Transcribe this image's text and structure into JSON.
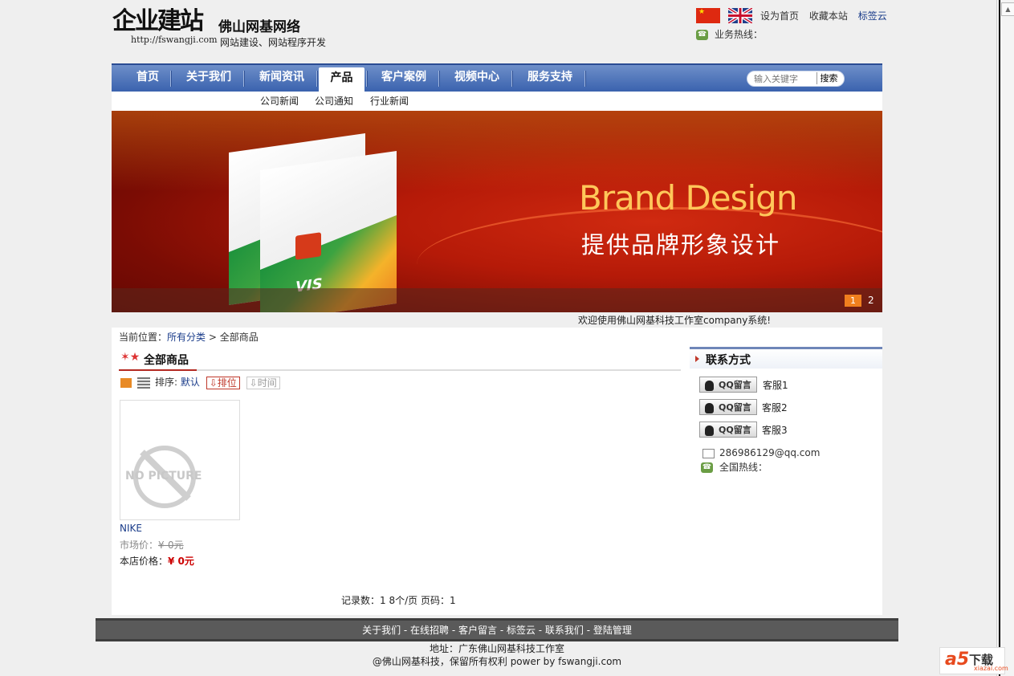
{
  "header": {
    "logo_title": "企业建站",
    "logo_url": "http://fswangji.com",
    "company_name": "佛山网基网络",
    "slogan": "网站建设、网站程序开发",
    "top_links": [
      "设为首页",
      "收藏本站",
      "标签云"
    ],
    "hotline_label": "业务热线："
  },
  "nav": {
    "items": [
      "首页",
      "关于我们",
      "新闻资讯",
      "产品",
      "客户案例",
      "视频中心",
      "服务支持"
    ],
    "active": "产品",
    "search_placeholder": "输入关键字",
    "search_button": "搜索",
    "subnav": [
      "公司新闻",
      "公司通知",
      "行业新闻"
    ]
  },
  "banner": {
    "title_en": "Brand Design",
    "title_cn": "提供品牌形象设计",
    "box_text": "VIS",
    "pager": [
      "1",
      "2"
    ]
  },
  "welcome": "欢迎使用佛山网基科技工作室company系统!",
  "breadcrumb": {
    "label": "当前位置：",
    "link": "所有分类",
    "separator": ">",
    "current": "全部商品"
  },
  "section": {
    "title": "全部商品",
    "sort_label": "排序:",
    "sort_default": "默认",
    "sort_rank": "排位",
    "sort_time": "时间"
  },
  "product": {
    "placeholder_text": "NO PICTURE",
    "name": "NIKE",
    "market_price_label": "市场价：",
    "market_price": "¥-0元",
    "shop_price_label": "本店价格：",
    "shop_price": "¥ 0元"
  },
  "pagination": {
    "records": "记录数：1",
    "per_page": "8个/页",
    "page": "页码：1"
  },
  "sidebar": {
    "title": "联系方式",
    "qq_button": "QQ留言",
    "services": [
      "客服1",
      "客服2",
      "客服3"
    ],
    "email": "286986129@qq.com",
    "hotline_label": "全国热线："
  },
  "footer": {
    "links": "关于我们 - 在线招聘 - 客户留言 - 标签云 - 联系我们 - 登陆管理",
    "address": "地址：广东佛山网基科技工作室",
    "copyright": "@佛山网基科技，保留所有权利  power by fswangji.com"
  },
  "watermark": {
    "logo": "a5",
    "text": "下载",
    "site": "xiazai.com"
  },
  "colors": {
    "nav_blue": "#3a62ae",
    "accent_orange": "#f07f1e",
    "price_red": "#cc0000",
    "footer_gray": "#5a5a5a"
  }
}
